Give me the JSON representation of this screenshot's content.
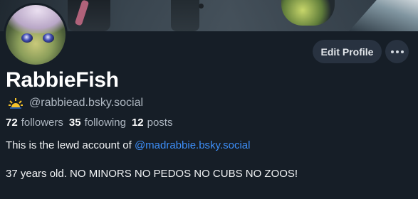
{
  "profile": {
    "display_name": "RabbieFish",
    "handle": "@rabbiead.bsky.social",
    "handle_icon": "sun-icon"
  },
  "stats": {
    "followers_count": "72",
    "followers_label": "followers",
    "following_count": "35",
    "following_label": "following",
    "posts_count": "12",
    "posts_label": "posts"
  },
  "bio": {
    "line1_prefix": "This is the lewd account of ",
    "line1_link": "@madrabbie.bsky.social",
    "line2": "37 years old. NO MINORS NO PEDOS NO CUBS NO ZOOS!"
  },
  "actions": {
    "edit_profile_label": "Edit Profile",
    "more_icon": "more-dots-icon"
  },
  "colors": {
    "background": "#161e27",
    "button_bg": "#283240",
    "link": "#3d8ef7",
    "muted_text": "#aeb7c1"
  }
}
